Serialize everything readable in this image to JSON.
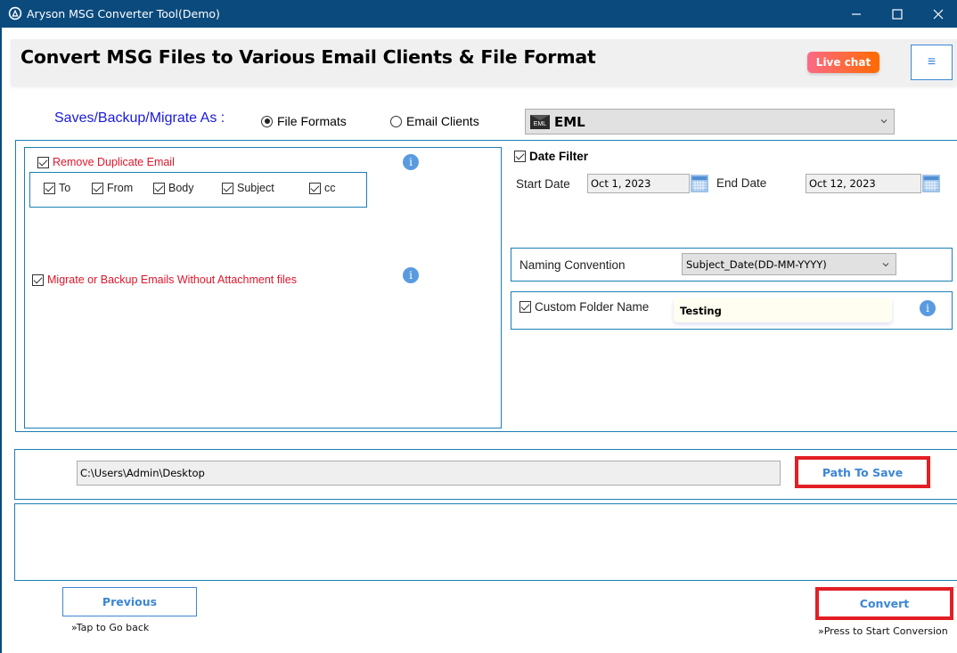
{
  "window": {
    "title": "Aryson MSG Converter Tool(Demo)",
    "controls": [
      "minimize",
      "maximize",
      "close"
    ]
  },
  "header": {
    "heading": "Convert MSG Files to Various Email Clients & File Format",
    "live_chat_label": "Live chat",
    "menu_icon": "≡"
  },
  "save_as": {
    "label": "Saves/Backup/Migrate As :",
    "options": [
      {
        "label": "File Formats",
        "selected": true
      },
      {
        "label": "Email Clients",
        "selected": false
      }
    ],
    "format_icon_text": "EML",
    "format_value": "EML"
  },
  "options": {
    "remove_duplicate": {
      "label": "Remove Duplicate Email",
      "checked": true,
      "fields": [
        {
          "label": "To",
          "checked": true
        },
        {
          "label": "From",
          "checked": true
        },
        {
          "label": "Body",
          "checked": true
        },
        {
          "label": "Subject",
          "checked": true
        },
        {
          "label": "cc",
          "checked": true
        }
      ]
    },
    "without_attachments": {
      "label": "Migrate or Backup Emails Without Attachment files",
      "checked": true
    },
    "info_glyph": "i"
  },
  "date_filter": {
    "label": "Date Filter",
    "checked": true,
    "start_label": "Start Date",
    "start_value": "Oct 1, 2023",
    "end_label": "End Date",
    "end_value": "Oct 12, 2023"
  },
  "naming": {
    "label": "Naming Convention",
    "value": "Subject_Date(DD-MM-YYYY)"
  },
  "custom_folder": {
    "label": "Custom Folder Name",
    "checked": true,
    "value": "Testing"
  },
  "path": {
    "value": "C:\\Users\\Admin\\Desktop",
    "button_label": "Path To Save"
  },
  "footer": {
    "previous_label": "Previous",
    "previous_hint": "»Tap to Go back",
    "convert_label": "Convert",
    "convert_hint": "»Press to Start Conversion"
  },
  "colors": {
    "titlebar": "#0b4a7d",
    "border_blue": "#1a7fb5",
    "accent_blue": "#3b86d6",
    "highlight_red": "#e31e25",
    "label_red": "#e0162b",
    "label_blue": "#1a1adc"
  }
}
